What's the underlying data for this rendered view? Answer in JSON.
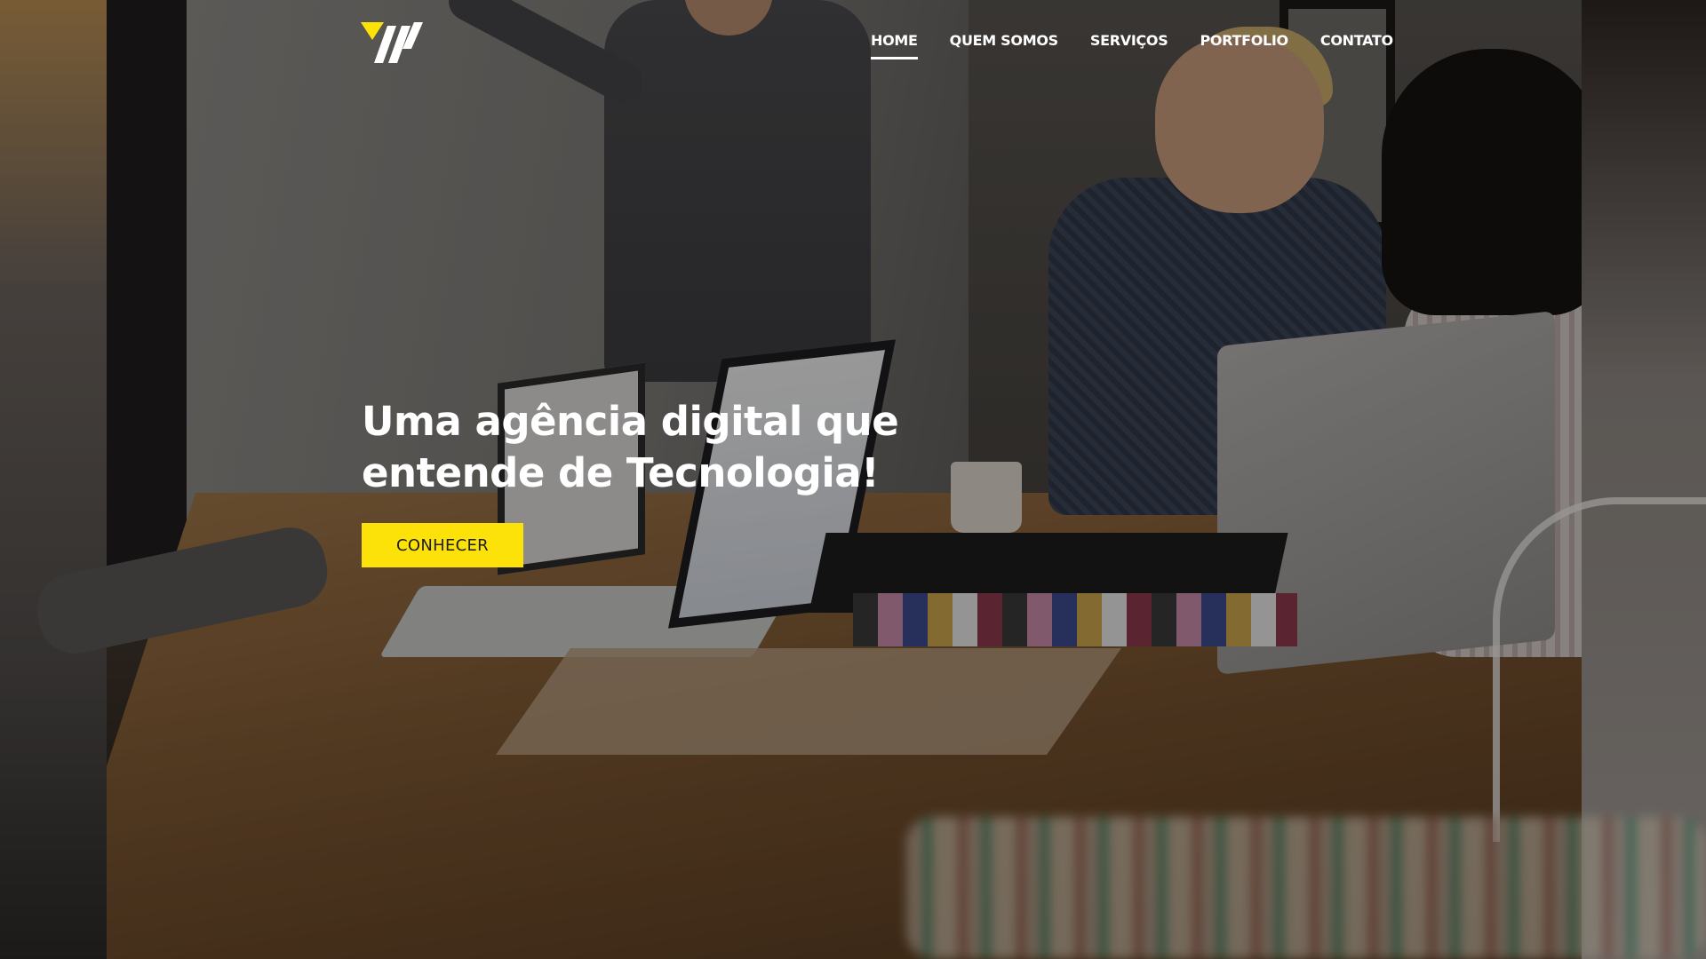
{
  "nav": {
    "items": [
      {
        "label": "HOME",
        "active": true
      },
      {
        "label": "QUEM SOMOS",
        "active": false
      },
      {
        "label": "SERVIÇOS",
        "active": false
      },
      {
        "label": "PORTFOLIO",
        "active": false
      },
      {
        "label": "CONTATO",
        "active": false
      }
    ]
  },
  "logo": {
    "icon": "brand-logo-icon",
    "colors": {
      "accent": "#fde209",
      "primary": "#ffffff"
    }
  },
  "hero": {
    "title": "Uma agência digital que entende de Tecnologia!",
    "cta_label": "CONHECER",
    "background": "team-meeting-photo"
  },
  "colors": {
    "accent": "#fde209",
    "text": "#ffffff"
  }
}
